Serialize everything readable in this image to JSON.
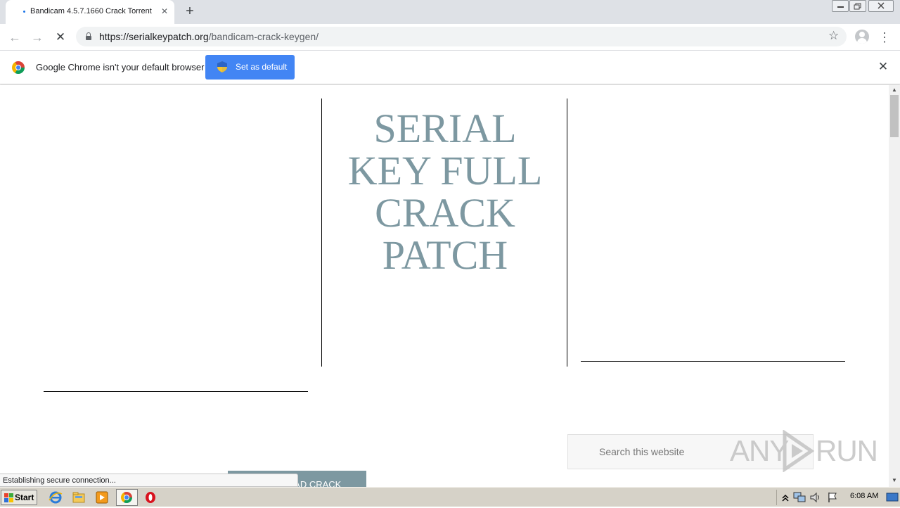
{
  "browser": {
    "tab_title": "Bandicam 4.5.7.1660 Crack Torrent",
    "new_tab_symbol": "+",
    "url_host": "https://serialkeypatch.org",
    "url_path": "/bandicam-crack-keygen/"
  },
  "infobar": {
    "message": "Google Chrome isn't your default browser",
    "button_label": "Set as default"
  },
  "page": {
    "site_title": "SERIAL KEY FULL CRACK PATCH",
    "search_placeholder": "Search this website",
    "download_button_label": "DOWNLOAD CRACK",
    "download_button_visible_text": "D CRACK",
    "status_text": "Establishing secure connection..."
  },
  "watermark": {
    "left": "ANY",
    "right": "RUN"
  },
  "taskbar": {
    "start_label": "Start",
    "clock": "6:08 AM",
    "pinned": [
      "ie-icon",
      "explorer-icon",
      "media-player-icon",
      "chrome-icon",
      "opera-icon"
    ]
  },
  "colors": {
    "site_accent": "#7d98a1",
    "chrome_blue": "#4285f4",
    "tab_strip": "#dee1e6",
    "taskbar": "#d6d2c8"
  }
}
